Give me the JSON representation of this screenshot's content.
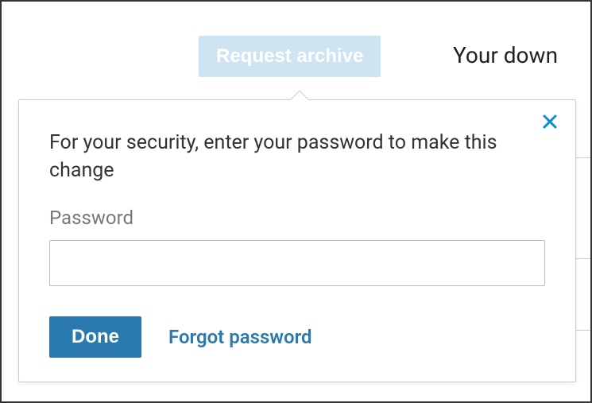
{
  "background": {
    "request_archive_label": "Request archive",
    "your_download_text": "Your down"
  },
  "popover": {
    "message": "For your security, enter your password to make this change",
    "password_label": "Password",
    "password_value": "",
    "done_label": "Done",
    "forgot_label": "Forgot password"
  }
}
